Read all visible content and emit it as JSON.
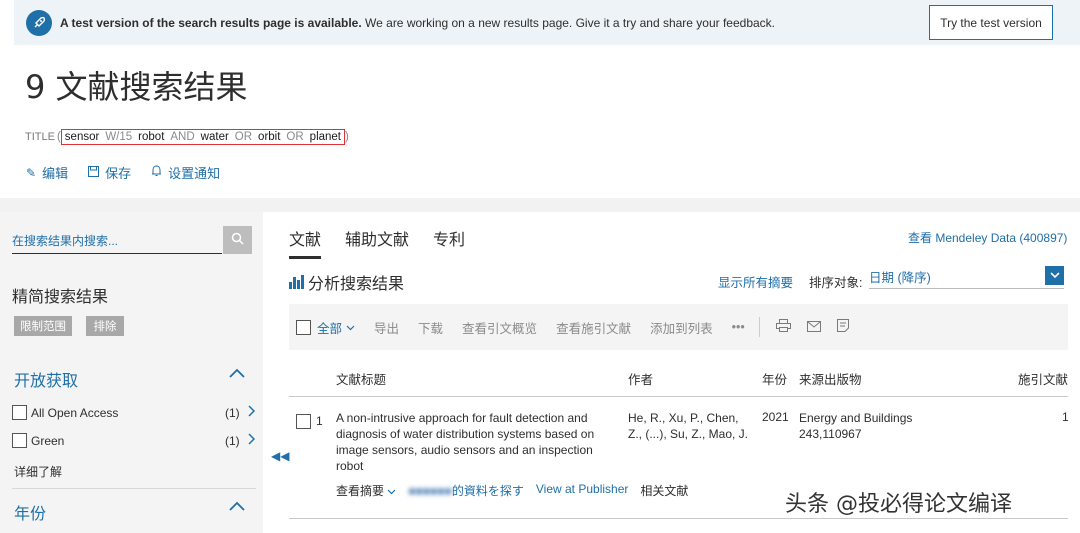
{
  "banner": {
    "bold_text": "A test version of the search results page is available.",
    "text": " We are working on a new results page. Give it a try and share your feedback.",
    "button": "Try the test version"
  },
  "page_title": "9 文献搜索结果",
  "query": {
    "label": "TITLE",
    "open_paren": "(",
    "close_paren": ")",
    "terms": [
      "sensor",
      "W/15",
      "robot",
      "AND",
      "water",
      "OR",
      "orbit",
      "OR",
      "planet"
    ]
  },
  "actions": {
    "edit": "编辑",
    "save": "保存",
    "alert": "设置通知"
  },
  "sidebar": {
    "search_placeholder": "在搜索结果内搜索...",
    "refine_title": "精简搜索结果",
    "limit_chip": "限制范围",
    "exclude_chip": "排除",
    "open_access_title": "开放获取",
    "items": [
      {
        "label": "All Open Access",
        "count": "(1)"
      },
      {
        "label": "Green",
        "count": "(1)"
      }
    ],
    "learn_more": "详细了解",
    "year_title": "年份"
  },
  "tabs": [
    "文献",
    "辅助文献",
    "专利"
  ],
  "mendeley": "查看 Mendeley Data (400897)",
  "analyze": "分析搜索结果",
  "show_abstracts": "显示所有摘要",
  "sort": {
    "label": "排序对象:",
    "value": "日期 (降序)"
  },
  "toolbar": {
    "all": "全部",
    "export": "导出",
    "download": "下载",
    "citation_overview": "查看引文概览",
    "cited_by": "查看施引文献",
    "add_to_list": "添加到列表",
    "more": "•••"
  },
  "columns": {
    "title": "文献标题",
    "authors": "作者",
    "year": "年份",
    "source": "来源出版物",
    "cited": "施引文献"
  },
  "results": [
    {
      "num": "1",
      "title": "A non-intrusive approach for fault detection and diagnosis of water distribution systems based on image sensors, audio sensors and an inspection robot",
      "authors": "He, R., Xu, P., Chen, Z., (...), Su, Z., Mao, J.",
      "year": "2021",
      "source": "Energy and Buildings",
      "source_detail": "243,110967",
      "cited": "1",
      "links": {
        "abstract": "查看摘要",
        "find_resource": "的資料を探す",
        "publisher": "View at Publisher",
        "related": "相关文献"
      }
    }
  ],
  "watermark": "头条 @投必得论文编译",
  "colors": {
    "accent": "#1f6fa8",
    "highlight_border": "#e0303a"
  }
}
